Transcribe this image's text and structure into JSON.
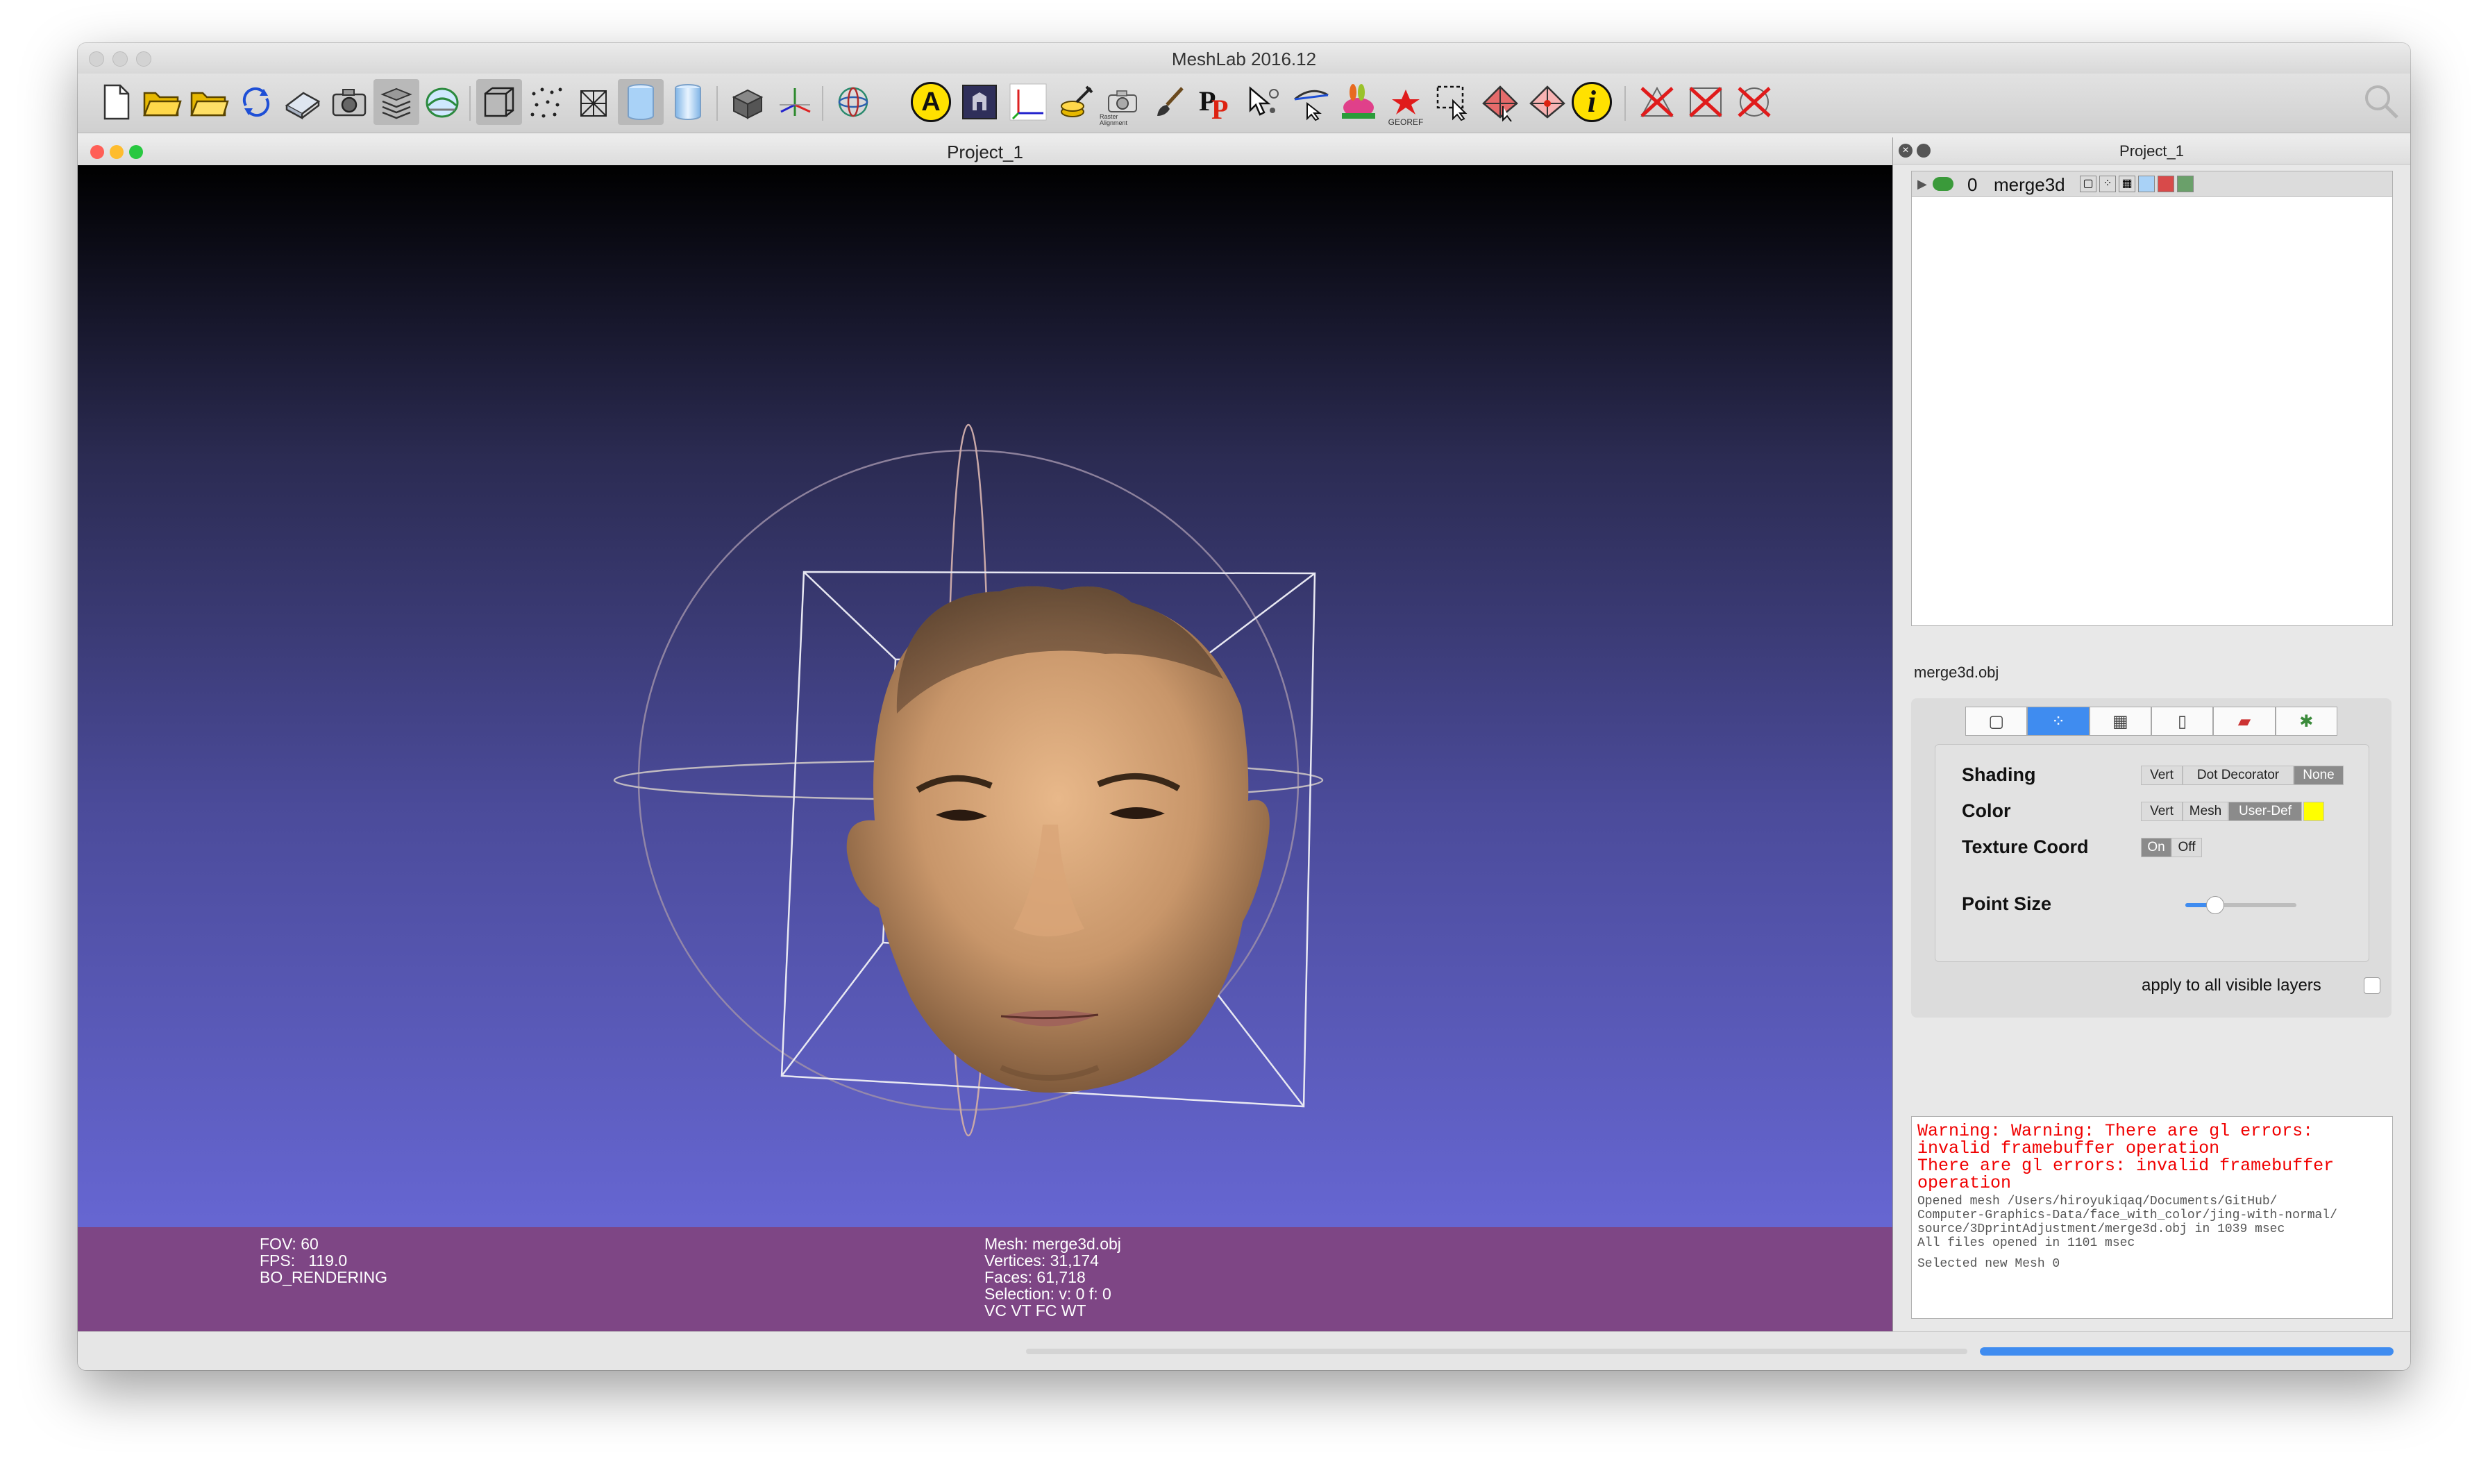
{
  "app": {
    "title": "MeshLab 2016.12"
  },
  "toolbar": {
    "icons": [
      "new-file",
      "open-folder",
      "open-project",
      "reload",
      "save",
      "snapshot",
      "layers",
      "rainbow-dome",
      "bbox",
      "points",
      "wireframe",
      "flat-shading",
      "smooth-shading",
      "grid-cube",
      "axes",
      "trackball",
      "label-a",
      "dark-box",
      "camera-axes",
      "coins",
      "camera-alignment",
      "paintbrush",
      "pp-logo",
      "pick-points",
      "measure-tool",
      "georef-bunny",
      "georef-star",
      "select-tool",
      "delete-faces",
      "delete-verts",
      "info",
      "delete-x-1",
      "delete-x-2",
      "delete-x-3",
      "search"
    ],
    "raster_alignment_label": "Raster Alignment",
    "georef_label": "GEOREF",
    "a_label": "A",
    "info_label": "i",
    "pp_label": "PP"
  },
  "project": {
    "title": "Project_1"
  },
  "viewport": {
    "info_left": "FOV: 60\nFPS:   119.0\nBO_RENDERING",
    "info_mid": "Mesh: merge3d.obj\nVertices: 31,174\nFaces: 61,718\nSelection: v: 0 f: 0\nVC VT FC WT"
  },
  "layers": {
    "title": "Project_1",
    "row_index": "0",
    "row_name": "merge3d"
  },
  "properties": {
    "filename": "merge3d.obj",
    "shading_label": "Shading",
    "shading_options": [
      "Vert",
      "Dot Decorator",
      "None"
    ],
    "shading_selected": "None",
    "color_label": "Color",
    "color_options": [
      "Vert",
      "Mesh",
      "User-Def"
    ],
    "color_selected": "User-Def",
    "user_color": "#ffff00",
    "texcoord_label": "Texture Coord",
    "texcoord_options": [
      "On",
      "Off"
    ],
    "texcoord_selected": "On",
    "pointsize_label": "Point Size",
    "pointsize_value": 0.27,
    "apply_label": "apply to all visible layers",
    "apply_checked": false
  },
  "log": {
    "warn1": "Warning: Warning: There are gl errors:",
    "warn2": "invalid framebuffer operation",
    "warn3": "There are gl errors: invalid framebuffer",
    "warn4": "operation",
    "info1": "Opened mesh /Users/hiroyukiqaq/Documents/GitHub/",
    "info2": "Computer-Graphics-Data/face_with_color/jing-with-normal/",
    "info3": "source/3DprintAdjustment/merge3d.obj in 1039 msec",
    "info4": "All files opened in 1101 msec",
    "info5": "Selected new Mesh 0"
  },
  "progress": {
    "fraction": 1.0
  },
  "colors": {
    "info_bar": "#7e4685",
    "accent_blue": "#3f8cf0",
    "warning_red": "#f00000",
    "traffic_red": "#ff5f57",
    "traffic_yellow": "#febc2e",
    "traffic_green": "#28c840"
  }
}
